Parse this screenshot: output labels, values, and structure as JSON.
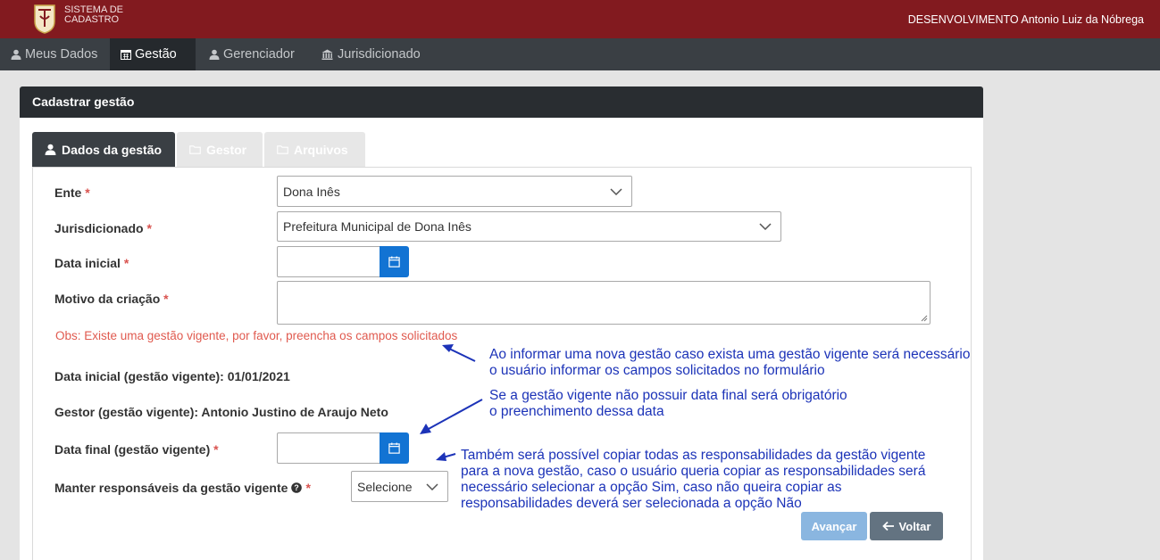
{
  "header": {
    "brand_line1": "SISTEMA DE",
    "brand_line2": "CADASTRO",
    "user_info": "DESENVOLVIMENTO Antonio Luiz da Nóbrega",
    "logo_icon": "crest-logo-icon"
  },
  "nav": {
    "items": [
      {
        "label": "Meus Dados",
        "icon": "user-icon"
      },
      {
        "label": "Gestão",
        "icon": "calendar-icon"
      },
      {
        "label": "Gerenciador",
        "icon": "user-icon"
      },
      {
        "label": "Jurisdicionado",
        "icon": "institution-icon"
      }
    ],
    "active": "Gestão"
  },
  "card": {
    "title": "Cadastrar gestão",
    "tabs": [
      {
        "label": "Dados da gestão",
        "icon": "user-icon",
        "active": true
      },
      {
        "label": "Gestor",
        "icon": "folder-icon",
        "active": false
      },
      {
        "label": "Arquivos",
        "icon": "folder-icon",
        "active": false
      }
    ]
  },
  "form": {
    "ente": {
      "label": "Ente",
      "value": "Dona Inês"
    },
    "jurisdicionado": {
      "label": "Jurisdicionado",
      "value": "Prefeitura Municipal de Dona Inês"
    },
    "data_inicial": {
      "label": "Data inicial",
      "value": ""
    },
    "motivo": {
      "label": "Motivo da criação",
      "value": ""
    },
    "required_mark": "*",
    "obs": "Obs: Existe uma gestão vigente, por favor, preencha os campos solicitados",
    "data_inicial_vigente": "Data inicial (gestão vigente): 01/01/2021",
    "gestor_vigente": "Gestor (gestão vigente): Antonio Justino de Araujo Neto",
    "data_final": {
      "label": "Data final (gestão vigente)",
      "value": ""
    },
    "manter": {
      "label": "Manter responsáveis da gestão vigente",
      "value": "Selecione",
      "help_icon": "question-circle-icon"
    }
  },
  "buttons": {
    "avancar": "Avançar",
    "voltar": "Voltar"
  },
  "annotations": {
    "note1": [
      "Ao informar uma nova gestão caso exista uma gestão vigente será necessário",
      "o usuário informar os campos solicitados no formulário"
    ],
    "note2": [
      "Se a gestão vigente não possuir data final será obrigatório",
      "o preenchimento dessa data"
    ],
    "note3": [
      "Também será possível copiar todas as responsabilidades da gestão vigente",
      "para a nova gestão, caso o usuário queria copiar as responsabilidades será",
      "necessário selecionar a opção Sim, caso não queira copiar as",
      "responsabilidades deverá ser selecionada a opção Não"
    ]
  },
  "colors": {
    "header_bg": "#821a1f",
    "nav_bg": "#3a3f44",
    "primary": "#1273d3",
    "annotation": "#1c33b8",
    "obs_text": "#e05a4f"
  }
}
